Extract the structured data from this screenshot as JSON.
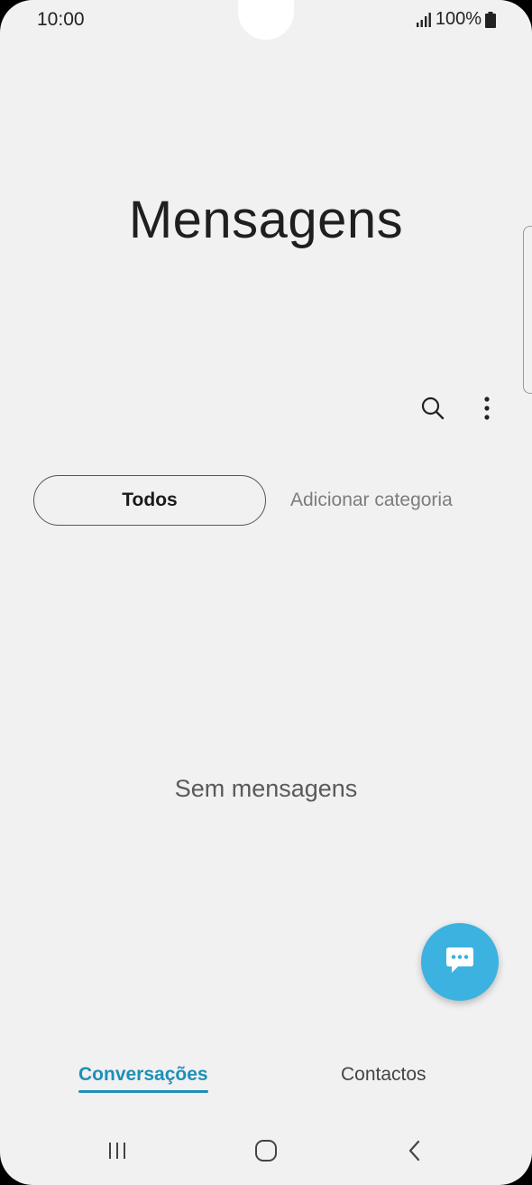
{
  "status_bar": {
    "time": "10:00",
    "battery": "100%",
    "icons": [
      "signal-icon",
      "battery-icon"
    ]
  },
  "app": {
    "title": "Mensagens"
  },
  "toolbar": {
    "icons": [
      "search-icon",
      "more-vert-icon"
    ]
  },
  "categories": {
    "selected": "Todos",
    "add_label": "Adicionar categoria"
  },
  "empty_state": {
    "text": "Sem mensagens"
  },
  "fab": {
    "icon": "new-message-icon",
    "color": "#3cb2e0"
  },
  "bottom_tabs": {
    "items": [
      {
        "label": "Conversações",
        "active": true
      },
      {
        "label": "Contactos",
        "active": false
      }
    ],
    "active_color": "#1e8fb8"
  },
  "nav_bar": {
    "icons": [
      "recent-apps-icon",
      "home-icon",
      "back-icon"
    ]
  }
}
